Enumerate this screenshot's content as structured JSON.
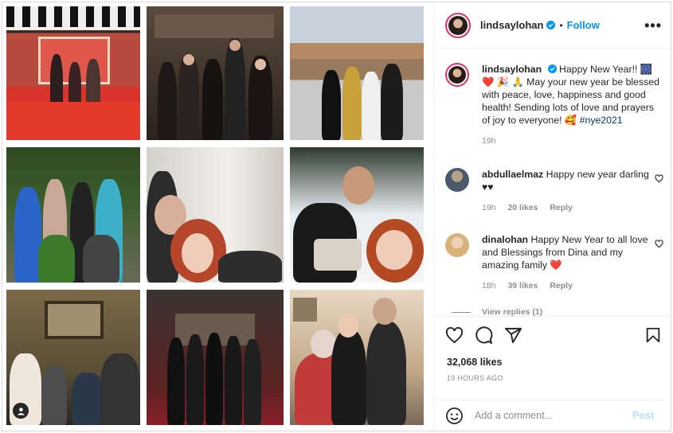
{
  "post": {
    "username": "lindsaylohan",
    "follow_label": "Follow",
    "separator": "•",
    "more_label": "•••"
  },
  "caption": {
    "username": "lindsaylohan",
    "text": "Happy New Year!! 🎆 ❤️ 🎉 🙏 May your new year be blessed with peace, love, happiness and good health! Sending lots of love and prayers of joy to everyone! 🥰",
    "hashtag": "#nye2021",
    "time": "19h"
  },
  "comments": [
    {
      "username": "abdullaelmaz",
      "text": "Happy new year darling ♥♥",
      "time": "19h",
      "likes": "20 likes",
      "reply": "Reply"
    },
    {
      "username": "dinalohan",
      "text": "Happy New Year to all love and Blessings from Dina and my amazing family ❤️",
      "time": "18h",
      "likes": "39 likes",
      "reply": "Reply"
    }
  ],
  "view_replies": "View replies (1)",
  "likes_count": "32,068 likes",
  "time_ago": "19 HOURS AGO",
  "add_comment": {
    "placeholder": "Add a comment...",
    "post_label": "Post"
  },
  "colors": {
    "accent": "#0095f6",
    "heart": "#ed4956",
    "muted": "#8e8e8e",
    "post_disabled": "#b2dffc"
  },
  "icons": [
    "heart-icon",
    "comment-icon",
    "share-icon",
    "save-icon",
    "emoji-icon",
    "more-icon",
    "verified-icon",
    "tagged-user-icon"
  ]
}
